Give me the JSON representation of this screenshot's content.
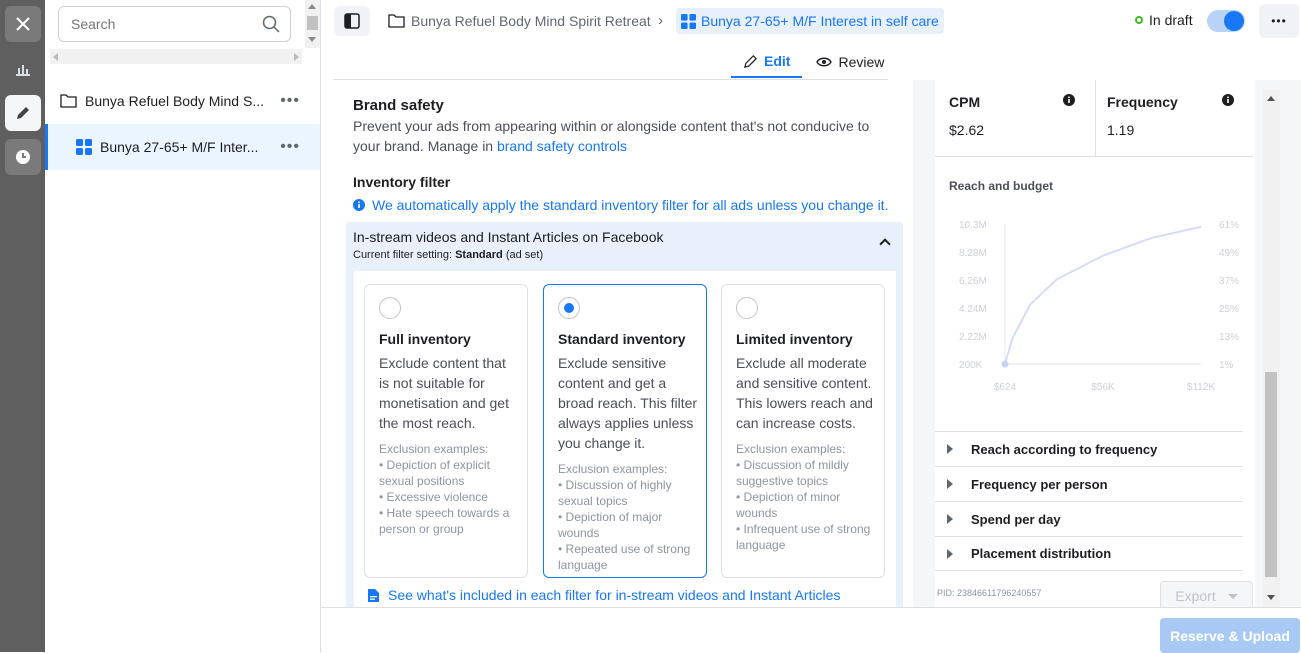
{
  "rail": {
    "items": [
      {
        "name": "close"
      },
      {
        "name": "charts"
      },
      {
        "name": "edit"
      },
      {
        "name": "history"
      }
    ]
  },
  "sidebar": {
    "search_placeholder": "Search",
    "campaign_label": "Bunya Refuel Body Mind S...",
    "adset_label": "Bunya 27-65+ M/F Inter..."
  },
  "header": {
    "campaign_crumb": "Bunya Refuel Body Mind Spirit Retreat",
    "adset_crumb": "Bunya 27-65+ M/F Interest in self care",
    "status": "In draft",
    "tab_edit": "Edit",
    "tab_review": "Review"
  },
  "brand_safety": {
    "title": "Brand safety",
    "desc_1": "Prevent your ads from appearing within or alongside content that's not conducive to",
    "desc_2": "your brand. Manage in ",
    "controls_link": "brand safety controls",
    "inventory_title": "Inventory filter",
    "inventory_notice": "We automatically apply the standard inventory filter for all ads unless you change it.",
    "section_title": "In-stream videos and Instant Articles on Facebook",
    "current_prefix": "Current filter setting: ",
    "current_value": "Standard",
    "current_suffix": " (ad set)",
    "see_link": "See what's included in each filter for in-stream videos and Instant Articles"
  },
  "cards": [
    {
      "title": "Full inventory",
      "desc": "Exclude content that is not suitable for monetisation and get the most reach.",
      "ex_title": "Exclusion examples:",
      "ex": [
        "Depiction of explicit sexual positions",
        "Excessive violence",
        "Hate speech towards a person or group"
      ]
    },
    {
      "title": "Standard inventory",
      "desc": "Exclude sensitive content and get a broad reach. This filter always applies unless you change it.",
      "ex_title": "Exclusion examples:",
      "ex": [
        "Discussion of highly sexual topics",
        "Depiction of major wounds",
        "Repeated use of strong language"
      ]
    },
    {
      "title": "Limited inventory",
      "desc": "Exclude all moderate and sensitive content. This lowers reach and can increase costs.",
      "ex_title": "Exclusion examples:",
      "ex": [
        "Discussion of mildly suggestive topics",
        "Depiction of minor wounds",
        "Infrequent use of strong language"
      ]
    }
  ],
  "metrics": {
    "cpm_label": "CPM",
    "cpm_value": "$2.62",
    "freq_label": "Frequency",
    "freq_value": "1.19",
    "chart_title": "Reach and budget"
  },
  "chart_data": {
    "type": "line",
    "title": "Reach and budget",
    "x_ticks": [
      "$624",
      "$56K",
      "$112K"
    ],
    "y_left_ticks": [
      "10.3M",
      "8.28M",
      "6.26M",
      "4.24M",
      "2.22M",
      "200K"
    ],
    "y_right_ticks": [
      "61%",
      "49%",
      "37%",
      "25%",
      "13%",
      "1%"
    ],
    "series": [
      {
        "values": [
          [
            624,
            200000
          ],
          [
            5000,
            2100000
          ],
          [
            15000,
            4500000
          ],
          [
            30000,
            6300000
          ],
          [
            56000,
            8000000
          ],
          [
            84000,
            9300000
          ],
          [
            112000,
            10100000
          ]
        ]
      }
    ]
  },
  "accordions": [
    "Reach according to frequency",
    "Frequency per person",
    "Spend per day",
    "Placement distribution"
  ],
  "footer": {
    "pid": "PID: 23846611796240557",
    "export": "Export",
    "reserve": "Reserve & Upload"
  }
}
